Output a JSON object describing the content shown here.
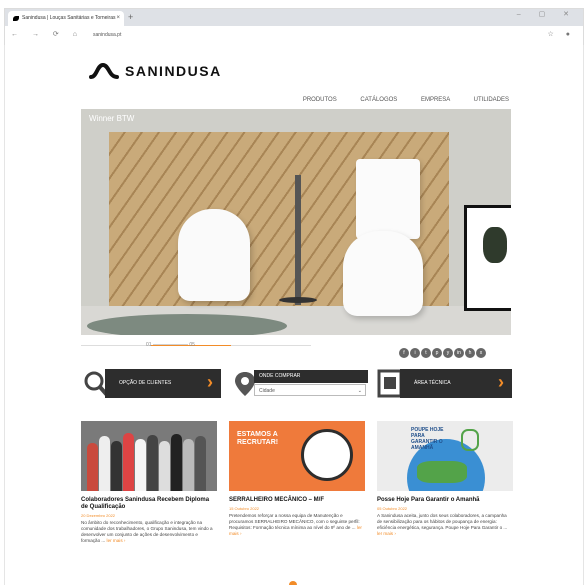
{
  "browser": {
    "tab_title": "Sanindusa | Louças Sanitárias e Torneiras",
    "tab_close": "×",
    "new_tab": "+",
    "window_controls": "– ▢ ✕",
    "nav_icons": "← → ⟳ ⌂",
    "url": "sanindusa.pt",
    "extension_icons": "☆ ●"
  },
  "site": {
    "logo_text": "SANINDUSA",
    "menu": [
      "PRODUTOS",
      "CATÁLOGOS",
      "EMPRESA",
      "UTILIDADES"
    ],
    "hero_caption": "Winner BTW",
    "slide_counter": "01 ——————— 05",
    "social": [
      "f",
      "i",
      "t",
      "p",
      "y",
      "in",
      "h",
      "x"
    ],
    "cards": {
      "stores_label": "OPÇÃO DE CLIENTES",
      "where_buy_label": "ONDE COMPRAR",
      "where_buy_value": "Cidade",
      "tech_area_label": "ÁREA TÉCNICA",
      "arrow": "›"
    },
    "news": [
      {
        "title": "Colaboradores Sanindusa Recebem Diploma de Qualificação",
        "date": "20 Dezembro 2022",
        "excerpt": "No âmbito do reconhecimento, qualificação e integração na comunidade dos trabalhadores, o Grupo Sanindusa, tem vindo a desenvolver um conjunto de ações de desenvolvimento e formação ...",
        "more": "ler mais ›"
      },
      {
        "title": "SERRALHEIRO MECÂNICO – M/F",
        "date": "15 Outubro 2022",
        "excerpt": "Pretendemos reforçar a nossa equipa de Manutenção e procuramos SERRALHEIRO MECÂNICO, com o seguinte perfil: Requisitos: Formação técnica mínima ao nível do 9º ano de ...",
        "more": "ler mais ›",
        "image_text": "ESTAMOS A RECRUTAR!"
      },
      {
        "title": "Posse Hoje Para Garantir o Amanhã",
        "date": "05 Outubro 2022",
        "excerpt": "A Sanindusa aceita, junto dos seus colaboradores, a campanha de sensibilização para os hábitos de poupança de energia: eficiência energética, segurança. Poupe Hoje Para Garantir o ...",
        "more": "ler mais ›",
        "image_text": "POUPE HOJE PARA GARANTIR O AMANHÃ"
      }
    ]
  },
  "colors": {
    "accent": "#f28c28",
    "dark": "#2d2d2d"
  }
}
